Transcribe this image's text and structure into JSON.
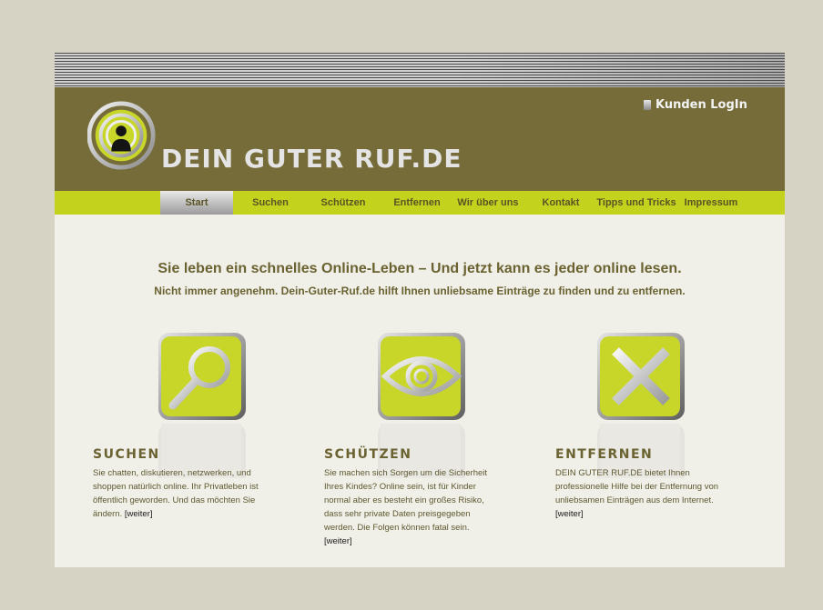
{
  "header": {
    "site_title": "DEIN GUTER RUF.DE",
    "login_label": "Kunden LogIn"
  },
  "nav": {
    "items": [
      {
        "label": "Start",
        "active": true
      },
      {
        "label": "Suchen"
      },
      {
        "label": "Schützen"
      },
      {
        "label": "Entfernen"
      },
      {
        "label": "Wir über uns"
      },
      {
        "label": "Kontakt"
      },
      {
        "label": "Tipps und Tricks"
      },
      {
        "label": "Impressum"
      }
    ]
  },
  "intro": {
    "headline": "Sie leben ein schnelles Online-Leben – Und jetzt kann es jeder online lesen.",
    "subline": "Nicht immer angenehm. Dein-Guter-Ruf.de hilft Ihnen unliebsame Einträge zu finden und zu entfernen."
  },
  "features": [
    {
      "icon": "magnifier-icon",
      "title": "SUCHEN",
      "lines": [
        "Sie chatten, diskutieren, netzwerken, und",
        "shoppen natürlich online. Ihr Privatleben ist",
        "öffentlich geworden. Und das möchten Sie",
        "ändern."
      ],
      "link": "[weiter]"
    },
    {
      "icon": "eye-icon",
      "title": "SCHÜTZEN",
      "lines": [
        "Sie machen sich Sorgen um die Sicherheit",
        "Ihres Kindes? Online sein, ist für Kinder",
        "normal aber es besteht ein großes Risiko,",
        "dass sehr private Daten preisgegeben",
        "werden. Die Folgen können fatal sein."
      ],
      "link": "[weiter]"
    },
    {
      "icon": "x-icon",
      "title": "ENTFERNEN",
      "lines": [
        "DEIN GUTER RUF.DE bietet Ihnen",
        "professionelle Hilfe bei der Entfernung von",
        "unliebsamen  Einträgen aus dem Internet."
      ],
      "link": "[weiter]"
    }
  ],
  "colors": {
    "header_bg": "#756c3a",
    "nav_bg": "#c3d31d",
    "accent_lime": "#c8d62a",
    "text_olive": "#6a6231",
    "page_bg": "#f0efe8",
    "outer_bg": "#d6d3c4"
  }
}
